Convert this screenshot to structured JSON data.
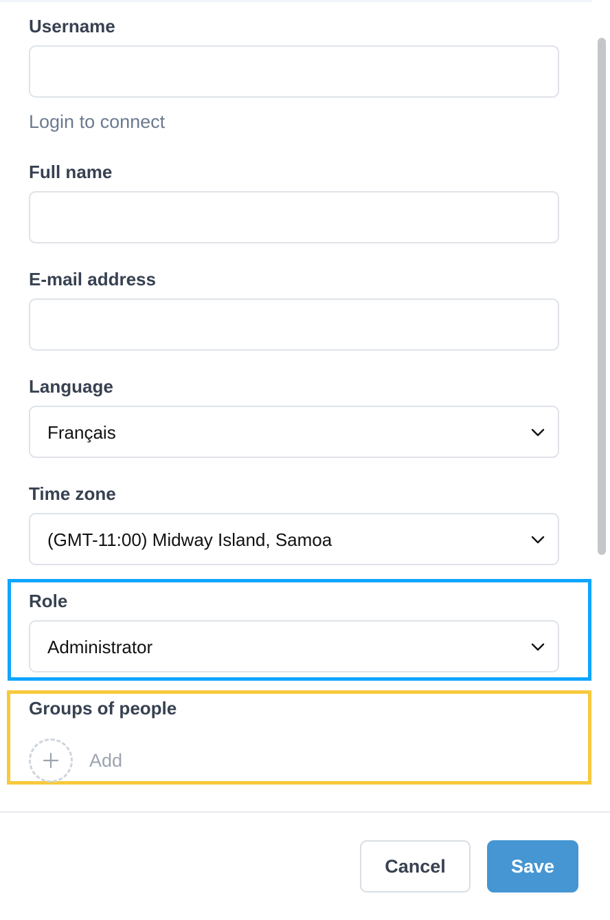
{
  "form": {
    "username": {
      "label": "Username",
      "value": "",
      "hint": "Login to connect"
    },
    "full_name": {
      "label": "Full name",
      "value": ""
    },
    "email": {
      "label": "E-mail address",
      "value": ""
    },
    "language": {
      "label": "Language",
      "selected": "Français"
    },
    "timezone": {
      "label": "Time zone",
      "selected": "(GMT-11:00) Midway Island, Samoa"
    },
    "role": {
      "label": "Role",
      "selected": "Administrator"
    },
    "groups": {
      "label": "Groups of people",
      "add_label": "Add"
    }
  },
  "footer": {
    "cancel_label": "Cancel",
    "save_label": "Save"
  },
  "colors": {
    "primary_button": "#4596d2",
    "highlight_role": "#0ea5ff",
    "highlight_groups": "#f8c93c"
  },
  "icons": {
    "select_arrow": "chevron-down-icon",
    "add": "plus-icon"
  }
}
